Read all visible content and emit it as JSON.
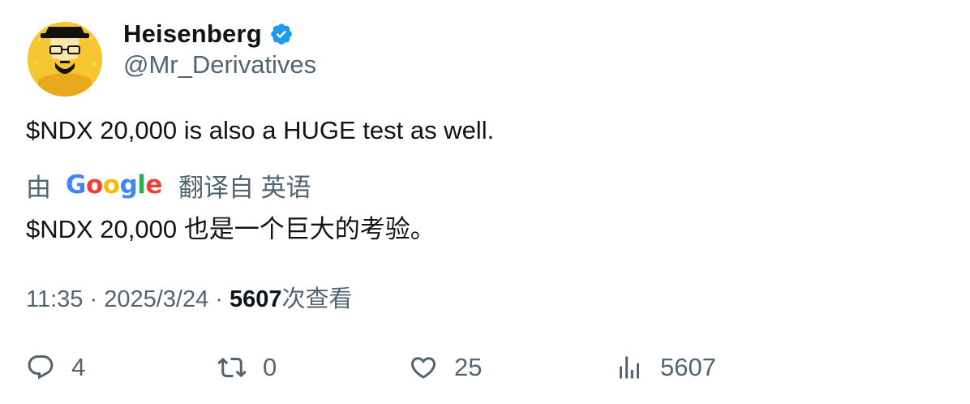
{
  "author": {
    "display_name": "Heisenberg",
    "handle": "@Mr_Derivatives",
    "verified": true,
    "verified_color": "#1d9bf0",
    "avatar_icon": "heisenberg-avatar"
  },
  "tweet": {
    "text": "$NDX 20,000 is also a HUGE test as well."
  },
  "translation": {
    "by_label": "由",
    "provider_letters": [
      "G",
      "o",
      "o",
      "g",
      "l",
      "e"
    ],
    "from_label": "翻译自 英语",
    "text": "$NDX 20,000 也是一个巨大的考验。"
  },
  "meta": {
    "time": "11:35",
    "separator": "·",
    "date": "2025/3/24",
    "views_count": "5607",
    "views_label": "次查看"
  },
  "actions": {
    "reply": {
      "icon": "reply-icon",
      "count": "4"
    },
    "retweet": {
      "icon": "retweet-icon",
      "count": "0"
    },
    "like": {
      "icon": "heart-icon",
      "count": "25"
    },
    "views": {
      "icon": "views-icon",
      "count": "5607"
    }
  },
  "colors": {
    "text_primary": "#0f1419",
    "text_secondary": "#536471",
    "avatar_background": "#f6c630"
  }
}
